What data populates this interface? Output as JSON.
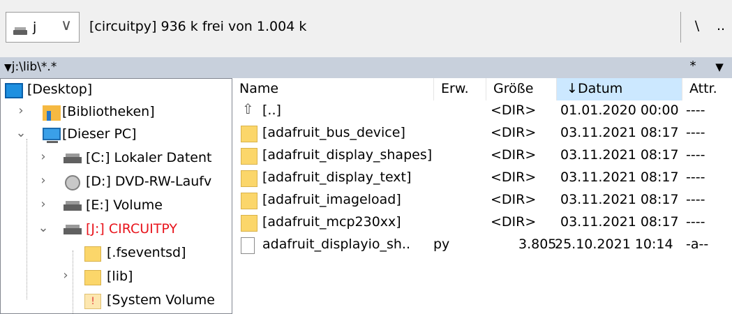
{
  "drive": {
    "letter": "j",
    "chevron": "∨",
    "info": "[circuitpy]  936 k frei von 1.004 k",
    "root_label": "\\",
    "up_label": ".."
  },
  "path": {
    "text": "j:\\lib\\*.*",
    "filter_label": "*",
    "history_label": "▼"
  },
  "tree": [
    {
      "label": "[Desktop]"
    },
    {
      "label": "[Bibliotheken]"
    },
    {
      "label": "[Dieser PC]"
    },
    {
      "label": "[C:]  Lokaler Datent"
    },
    {
      "label": "[D:]  DVD-RW-Laufv"
    },
    {
      "label": "[E:]  Volume"
    },
    {
      "label": "[J:]  CIRCUITPY",
      "color": "#e8141c"
    },
    {
      "label": "[.fseventsd]"
    },
    {
      "label": "[lib]"
    },
    {
      "label": "[System Volume"
    }
  ],
  "columns": {
    "name": "Name",
    "ext": "Erw.",
    "size": "Größe",
    "date": "Datum",
    "attr": "Attr."
  },
  "files": [
    {
      "name": "[..]",
      "ext": "",
      "size": "<DIR>",
      "date": "01.01.2020 00:00",
      "attr": "----"
    },
    {
      "name": "[adafruit_bus_device]",
      "ext": "",
      "size": "<DIR>",
      "date": "03.11.2021 08:17",
      "attr": "----"
    },
    {
      "name": "[adafruit_display_shapes]",
      "ext": "",
      "size": "<DIR>",
      "date": "03.11.2021 08:17",
      "attr": "----"
    },
    {
      "name": "[adafruit_display_text]",
      "ext": "",
      "size": "<DIR>",
      "date": "03.11.2021 08:17",
      "attr": "----"
    },
    {
      "name": "[adafruit_imageload]",
      "ext": "",
      "size": "<DIR>",
      "date": "03.11.2021 08:17",
      "attr": "----"
    },
    {
      "name": "[adafruit_mcp230xx]",
      "ext": "",
      "size": "<DIR>",
      "date": "03.11.2021 08:17",
      "attr": "----"
    },
    {
      "name": "adafruit_displayio_sh..",
      "ext": "py",
      "size": "3.805",
      "date": "25.10.2021 10:14",
      "attr": "-a--"
    }
  ],
  "colors": {
    "path_bar": "#c8d0dc",
    "sorted_header": "#cce8ff",
    "active_drive": "#e8141c"
  }
}
